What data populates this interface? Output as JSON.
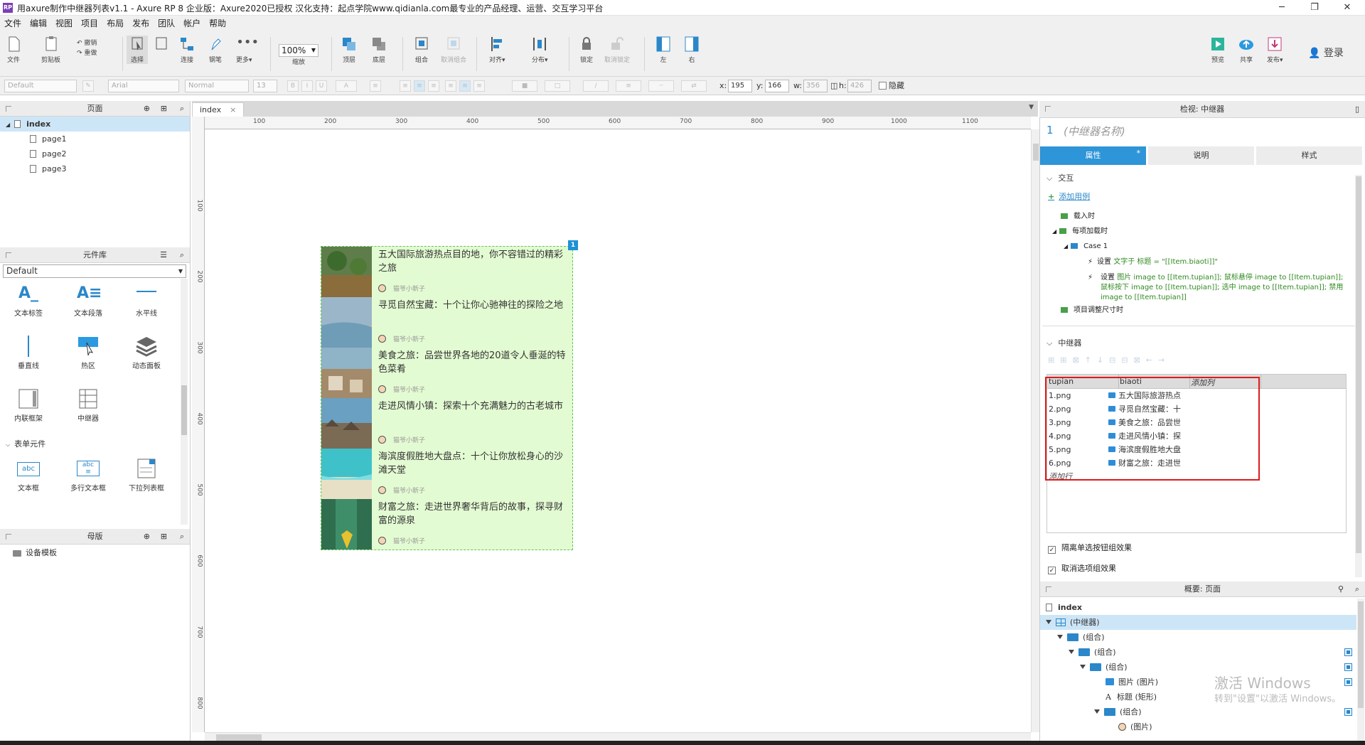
{
  "window": {
    "title": "用axure制作中继器列表v1.1 - Axure RP 8 企业版：Axure2020已授权 汉化支持：起点学院www.qidianla.com最专业的产品经理、运营、交互学习平台",
    "logo": "RP"
  },
  "menu": [
    "文件",
    "编辑",
    "视图",
    "项目",
    "布局",
    "发布",
    "团队",
    "帐户",
    "帮助"
  ],
  "toolbar": {
    "file": "文件",
    "clipboard": "剪贴板",
    "undo": "撤销",
    "redo": "重做",
    "select": "选择",
    "connect": "连接",
    "pen": "钢笔",
    "more": "更多▾",
    "zoom": "100%",
    "zoom_label": "缩放",
    "top": "顶层",
    "bottom": "底层",
    "group": "组合",
    "ungroup": "取消组合",
    "align": "对齐▾",
    "distribute": "分布▾",
    "lock": "锁定",
    "unlock": "取消锁定",
    "left": "左",
    "right": "右",
    "preview": "预览",
    "share": "共享",
    "publish": "发布▾",
    "login": "登录"
  },
  "format": {
    "style": "Default",
    "font": "Arial",
    "weight": "Normal",
    "size": "13",
    "x_label": "x:",
    "x": "195",
    "y_label": "y:",
    "y": "166",
    "w_label": "w:",
    "w": "356",
    "h_label": "h:",
    "h": "426",
    "hidden": "隐藏"
  },
  "pages_panel": {
    "title": "页面",
    "items": [
      {
        "label": "index"
      },
      {
        "label": "page1"
      },
      {
        "label": "page2"
      },
      {
        "label": "page3"
      }
    ]
  },
  "library_panel": {
    "title": "元件库",
    "selected": "Default",
    "widgets": [
      "文本标签",
      "文本段落",
      "水平线",
      "垂直线",
      "热区",
      "动态面板",
      "内联框架",
      "中继器"
    ],
    "form_section": "表单元件",
    "form_widgets": [
      "文本框",
      "多行文本框",
      "下拉列表框"
    ]
  },
  "masters_panel": {
    "title": "母版",
    "items": [
      "设备模板"
    ]
  },
  "canvas": {
    "tab": "index",
    "ruler_h": [
      "100",
      "200",
      "300",
      "400",
      "500",
      "600",
      "700",
      "800",
      "900",
      "1000",
      "1100"
    ],
    "ruler_v": [
      "100",
      "200",
      "300",
      "400",
      "500",
      "600",
      "700",
      "800"
    ],
    "badge": "1",
    "items": [
      {
        "title": "五大国际旅游热点目的地，你不容错过的精彩之旅",
        "author": "猫爷小新子"
      },
      {
        "title": "寻觅自然宝藏：十个让你心驰神往的探险之地",
        "author": "猫爷小新子"
      },
      {
        "title": "美食之旅：品尝世界各地的20道令人垂涎的特色菜肴",
        "author": "猫爷小新子"
      },
      {
        "title": "走进风情小镇：探索十个充满魅力的古老城市",
        "author": "猫爷小新子"
      },
      {
        "title": "海滨度假胜地大盘点：十个让你放松身心的沙滩天堂",
        "author": "猫爷小新子"
      },
      {
        "title": "财富之旅：走进世界奢华背后的故事，探寻财富的源泉",
        "author": "猫爷小新子"
      }
    ]
  },
  "inspector": {
    "header": "检视: 中继器",
    "id": "1",
    "name_placeholder": "(中继器名称)",
    "tabs": [
      "属性",
      "说明",
      "样式"
    ],
    "interactions": "交互",
    "add_case": "添加用例",
    "events": {
      "on_load": "载入时",
      "on_item_load": "每项加载时",
      "case": "Case 1",
      "action1_prefix": "设置 ",
      "action1": "文字于 标题 = \"[[Item.biaoti]]\"",
      "action2_prefix": "设置 ",
      "action2": "图片 image to [[Item.tupian]]; 鼠标悬停 image to [[Item.tupian]]; 鼠标按下 image to [[Item.tupian]]; 选中 image to [[Item.tupian]]; 禁用 image to [[Item.tupian]]",
      "on_resize": "项目调整尺寸时"
    },
    "repeater_section": "中继器",
    "table": {
      "columns": [
        "tupian",
        "biaoti",
        "添加列"
      ],
      "rows": [
        {
          "tupian": "1.png",
          "biaoti": "五大国际旅游热点"
        },
        {
          "tupian": "2.png",
          "biaoti": "寻觅自然宝藏：十"
        },
        {
          "tupian": "3.png",
          "biaoti": "美食之旅：品尝世"
        },
        {
          "tupian": "4.png",
          "biaoti": "走进风情小镇：探"
        },
        {
          "tupian": "5.png",
          "biaoti": "海滨度假胜地大盘"
        },
        {
          "tupian": "6.png",
          "biaoti": "财富之旅：走进世"
        }
      ],
      "add_row": "添加行"
    },
    "check1": "隔离单选按钮组效果",
    "check2": "取消选项组效果"
  },
  "outline": {
    "header": "概要: 页面",
    "items": [
      {
        "label": "index"
      },
      {
        "label": "(中继器)"
      },
      {
        "label": "(组合)"
      },
      {
        "label": "(组合)"
      },
      {
        "label": "(组合)"
      },
      {
        "label": "图片 (图片)"
      },
      {
        "label": "标题 (矩形)"
      },
      {
        "label": "(组合)"
      },
      {
        "label": "(图片)"
      }
    ]
  },
  "watermark": {
    "line1": "激活 Windows",
    "line2": "转到\"设置\"以激活 Windows。"
  },
  "colors": {
    "accent": "#2e95d8",
    "repeater_bg": "#e3fbd2",
    "highlight": "#e01a1a"
  }
}
